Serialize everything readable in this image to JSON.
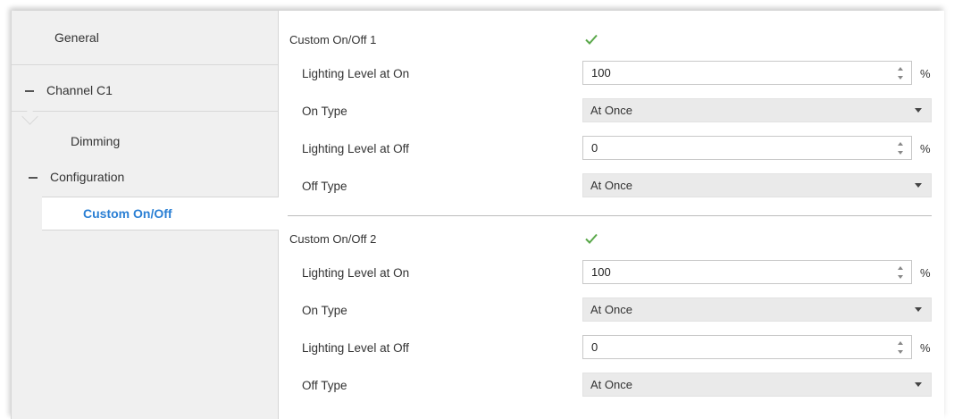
{
  "sidebar": {
    "items": [
      {
        "label": "General"
      },
      {
        "label": "Channel C1"
      },
      {
        "label": "Dimming"
      },
      {
        "label": "Configuration"
      },
      {
        "label": "Custom On/Off"
      }
    ]
  },
  "main": {
    "sections": [
      {
        "title": "Custom On/Off 1",
        "checked": true,
        "lighting_on": {
          "label": "Lighting Level at On",
          "value": "100",
          "unit": "%"
        },
        "on_type": {
          "label": "On Type",
          "value": "At Once"
        },
        "lighting_off": {
          "label": "Lighting Level at Off",
          "value": "0",
          "unit": "%"
        },
        "off_type": {
          "label": "Off Type",
          "value": "At Once"
        }
      },
      {
        "title": "Custom On/Off 2",
        "checked": true,
        "lighting_on": {
          "label": "Lighting Level at On",
          "value": "100",
          "unit": "%"
        },
        "on_type": {
          "label": "On Type",
          "value": "At Once"
        },
        "lighting_off": {
          "label": "Lighting Level at Off",
          "value": "0",
          "unit": "%"
        },
        "off_type": {
          "label": "Off Type",
          "value": "At Once"
        }
      }
    ]
  },
  "colors": {
    "accent": "#2a7fd4",
    "check": "#5aa84a",
    "sidebar_bg": "#f0f0f0",
    "select_bg": "#eaeaea"
  },
  "icons": {
    "checkbox": "checkmark-icon",
    "spinner": "spinner-arrows-icon",
    "dropdown": "chevron-down-icon",
    "collapse": "minus-icon"
  }
}
